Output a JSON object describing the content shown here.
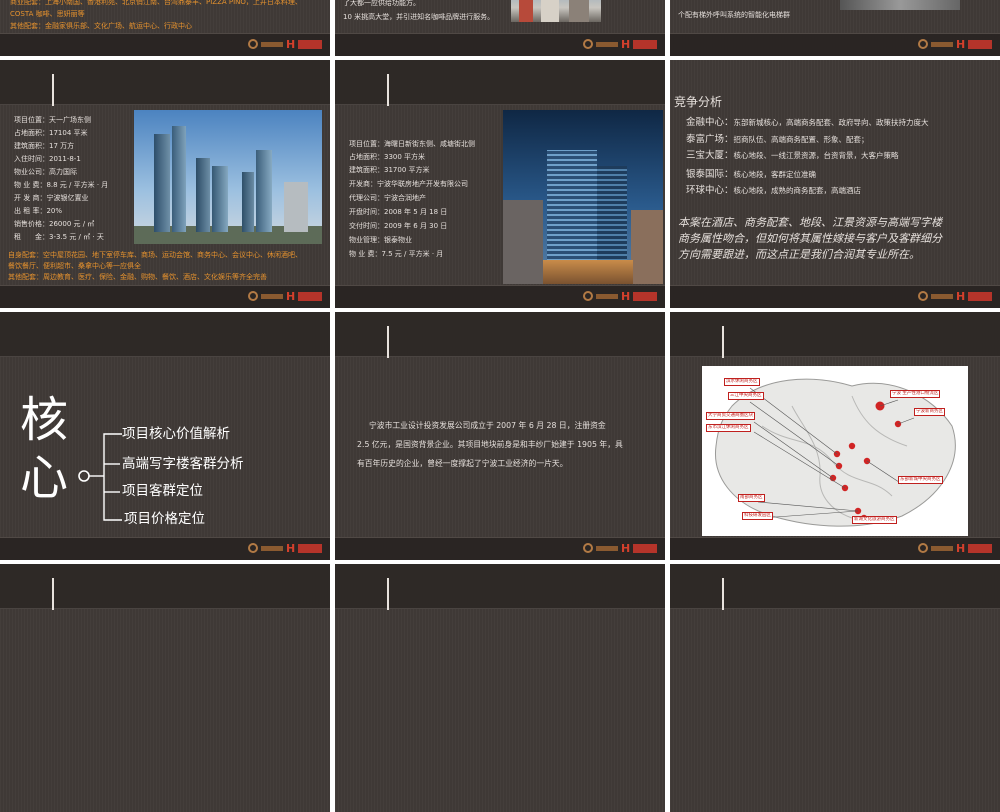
{
  "slide1": {
    "orange_lines": [
      "商业配套：上海小南国、香港利苑、北京俏江南、台湾鼎泰丰、PIZZA PINO，上井日本料理、",
      "COSTA 咖啡、思妍丽等",
      "其他配套：金融家俱乐部、文化广场、航运中心、行政中心"
    ]
  },
  "slide2": {
    "lines": [
      "了大都一应供给功能方。",
      "10 米挑高大堂，并引进知名咖啡品牌进行服务。"
    ]
  },
  "slide3": {
    "line": "个配有梯外呼叫系统的智能化电梯群"
  },
  "slide4": {
    "info_lines": [
      "项目位置：天一广场东侧",
      "占地面积：17104 平米",
      "建筑面积：17 万方",
      "入住时间：2011-8-1",
      "物业公司：高力国际",
      "物 业 费：8.8 元 / 平方米 · 月",
      "开 发 商：宁波银亿置业",
      "出 租 率：20%",
      "销售价格：26000 元 / ㎡",
      "租　　金：3-3.5 元 / ㎡ · 天"
    ],
    "orange_lines": [
      "自身配套：空中屋顶花园、地下室停车库、商场、运动会馆、商务中心、会议中心、休闲酒吧、",
      "餐饮餐厅、便利超市、桑拿中心等一应俱全",
      "其他配套：周边教育、医疗、保险、金融、购物、餐饮、酒店、文化娱乐等齐全完善"
    ]
  },
  "slide5": {
    "info_lines": [
      "项目位置：海曙日新街东侧、咸塘街北侧",
      "占地面积：3300 平方米",
      "建筑面积：31700 平方米",
      "开发商：宁波华联房地产开发有限公司",
      "代理公司：宁波合润地产",
      "开盘时间：2008 年 5 月 18 日",
      "交付时间：2009 年 6 月 30 日",
      "物业管理：银泰物业",
      "物 业 费：7.5 元 / 平方米 · 月"
    ]
  },
  "slide6": {
    "title": "竞争分析",
    "items": [
      {
        "name": "金融中心",
        "desc": "东部新城核心，高端商务配套、政府导向、政策扶持力度大"
      },
      {
        "name": "泰富广场",
        "desc": "招商队伍、高端商务配置、形象、配套；"
      },
      {
        "name": "三宝大厦",
        "desc": "核心地段、一线江景资源，台资背景，大客户策略"
      },
      {
        "name": "银泰国际",
        "desc": "核心地段，客群定位准确"
      },
      {
        "name": "环球中心",
        "desc": "核心地段，成熟的商务配套，高端酒店"
      }
    ],
    "italic_lines": [
      "本案在酒店、商务配套、地段、江景资源与高端写字楼",
      "商务属性吻合，但如何将其属性嫁接与客户及客群细分",
      "方向需要跟进，而这点正是我们合润其专业所在。"
    ]
  },
  "slide7": {
    "big_chars": [
      "核",
      "心"
    ],
    "items": [
      "项目核心价值解析",
      "高端写字楼客群分析",
      "项目客群定位",
      "项目价格定位"
    ]
  },
  "slide8": {
    "lines": [
      "宁波市工业设计投资发展公司成立于 2007 年 6 月 28 日，注册资金",
      "2.5 亿元，是国资背景企业。其项目地块前身是和丰纱厂始建于 1905 年，具",
      "有百年历史的企业，曾经一度撑起了宁波工业经济的一片天。"
    ]
  },
  "slide9": {
    "map_labels": [
      "滨水休闲商务区",
      "三江中央商务区",
      "大学商贸交通商圈区块",
      "东市滨江休闲商务区",
      "宁波 生产性港口物流区",
      "宁波新商务区",
      "东部新城中央商务区",
      "南部商务区",
      "科技研发园区",
      "新湖文化旅游商务区"
    ]
  },
  "colors": {
    "bg": "#3f3936",
    "orange": "#e6922e",
    "text": "#e6e0dc",
    "logo_red": "#d4402c"
  }
}
